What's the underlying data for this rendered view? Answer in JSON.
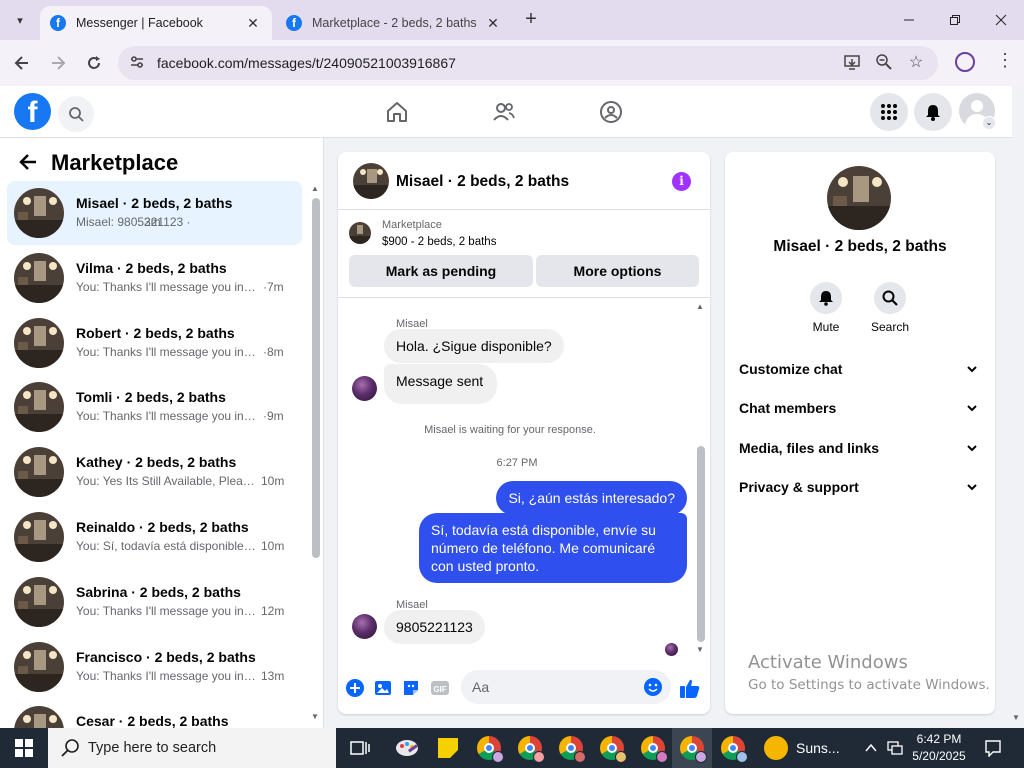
{
  "browser": {
    "tabs": [
      {
        "title": "Messenger | Facebook",
        "close": "✕"
      },
      {
        "title": "Marketplace - 2 beds, 2 baths |",
        "close": "✕"
      }
    ],
    "new_tab": "+",
    "url": "facebook.com/messages/t/24090521003916867"
  },
  "marketplace": {
    "title": "Marketplace",
    "conversations": [
      {
        "name": "Misael · 2 beds, 2 baths",
        "preview": "Misael: 9805221123 ·",
        "time": "3m"
      },
      {
        "name": "Vilma · 2 beds, 2 baths",
        "preview": "You: Thanks I'll message you in a ...",
        "time": "·7m"
      },
      {
        "name": "Robert · 2 beds, 2 baths",
        "preview": "You: Thanks I'll message you in a ...",
        "time": "·8m"
      },
      {
        "name": "Tomli · 2 beds, 2 baths",
        "preview": "You: Thanks I'll message you in a ...",
        "time": "·9m"
      },
      {
        "name": "Kathey · 2 beds, 2 baths",
        "preview": "You: Yes Its Still Available, Please ...",
        "time": "10m"
      },
      {
        "name": "Reinaldo · 2 beds, 2 baths",
        "preview": "You: Sí, todavía está disponible, e...",
        "time": "10m"
      },
      {
        "name": "Sabrina · 2 beds, 2 baths",
        "preview": "You: Thanks I'll message you in a ...",
        "time": "12m"
      },
      {
        "name": "Francisco · 2 beds, 2 baths",
        "preview": "You: Thanks I'll message you in a ...",
        "time": "13m"
      },
      {
        "name": "Cesar · 2 beds, 2 baths",
        "preview": "",
        "time": ""
      }
    ]
  },
  "chat": {
    "header_name": "Misael · 2 beds, 2 baths",
    "info_glyph": "i",
    "listing_source": "Marketplace",
    "listing_price": "$900 - 2 beds, 2 baths",
    "mark_pending": "Mark as pending",
    "more_options": "More options",
    "messages": {
      "sender1": "Misael",
      "in1": "Hola. ¿Sigue disponible?",
      "in2": "Message sent",
      "waiting": "Misael is waiting for your response.",
      "timestamp": "6:27 PM",
      "out1": "Si, ¿aún estás interesado?",
      "out2": "Sí, todavía está disponible, envíe su número de teléfono. Me comunicaré con usted pronto.",
      "sender2": "Misael",
      "in3": "9805221123"
    },
    "composer_placeholder": "Aa"
  },
  "info_panel": {
    "name": "Misael · 2 beds, 2 baths",
    "mute": "Mute",
    "search": "Search",
    "rows": [
      "Customize chat",
      "Chat members",
      "Media, files and links",
      "Privacy & support"
    ]
  },
  "watermark": {
    "line1": "Activate Windows",
    "line2": "Go to Settings to activate Windows."
  },
  "taskbar": {
    "search_placeholder": "Type here to search",
    "weather": "Suns...",
    "time": "6:42 PM",
    "date": "5/20/2025"
  },
  "colors": {
    "fb_blue": "#1877f2",
    "outgoing_bubble": "#2f4fee",
    "info_purple": "#a033ff",
    "active_row": "#e7f3ff"
  }
}
